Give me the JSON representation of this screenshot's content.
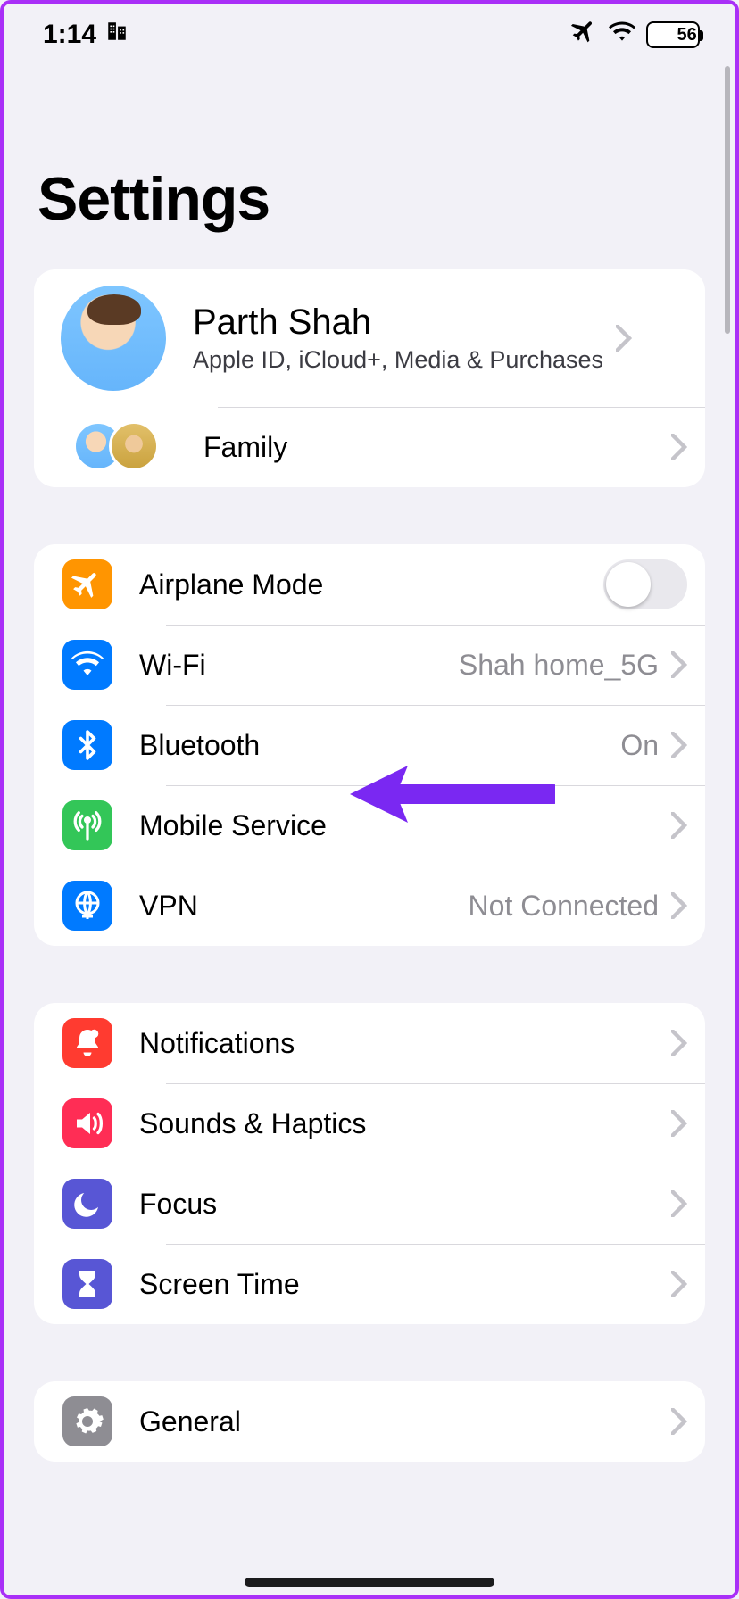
{
  "status": {
    "time": "1:14",
    "battery": "56"
  },
  "title": "Settings",
  "profile": {
    "name": "Parth Shah",
    "subtitle": "Apple ID, iCloud+, Media & Purchases",
    "family_label": "Family"
  },
  "group_connectivity": {
    "airplane": {
      "label": "Airplane Mode"
    },
    "wifi": {
      "label": "Wi-Fi",
      "detail": "Shah home_5G"
    },
    "bluetooth": {
      "label": "Bluetooth",
      "detail": "On"
    },
    "mobile": {
      "label": "Mobile Service"
    },
    "vpn": {
      "label": "VPN",
      "detail": "Not Connected"
    }
  },
  "group_system": {
    "notifications": {
      "label": "Notifications"
    },
    "sounds": {
      "label": "Sounds & Haptics"
    },
    "focus": {
      "label": "Focus"
    },
    "screentime": {
      "label": "Screen Time"
    }
  },
  "group_general": {
    "general": {
      "label": "General"
    }
  },
  "colors": {
    "orange": "#ff9501",
    "blue": "#007aff",
    "green": "#33c658",
    "red": "#ff3b30",
    "crimson": "#ff2d55",
    "indigo": "#5856d5",
    "gray": "#8e8d93"
  }
}
